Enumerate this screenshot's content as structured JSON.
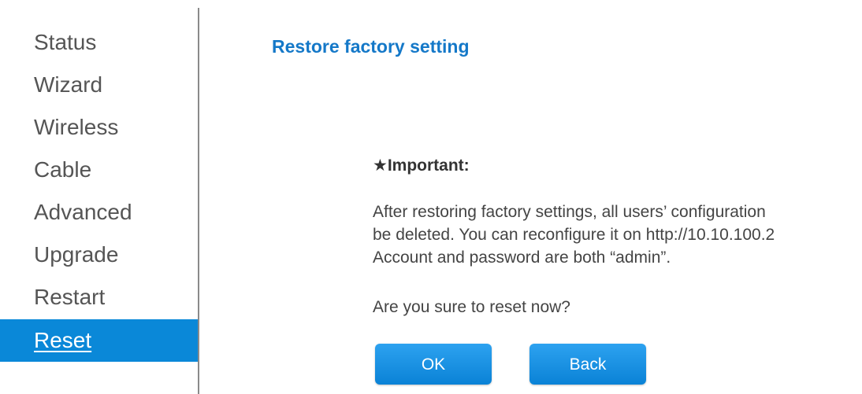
{
  "sidebar": {
    "items": [
      {
        "label": "Status"
      },
      {
        "label": "Wizard"
      },
      {
        "label": "Wireless"
      },
      {
        "label": "Cable"
      },
      {
        "label": "Advanced"
      },
      {
        "label": "Upgrade"
      },
      {
        "label": "Restart"
      },
      {
        "label": "Reset",
        "active": true
      }
    ]
  },
  "main": {
    "title": "Restore factory setting",
    "important_label": "★Important:",
    "message_lines": [
      "After restoring factory settings, all users’ configuration",
      "be deleted. You can reconfigure it on http://10.10.100.2",
      "Account and password are both “admin”."
    ],
    "question": "Are you sure to reset now?",
    "ok_label": "OK",
    "back_label": "Back"
  },
  "colors": {
    "accent": "#0a88d8",
    "title": "#1478c8",
    "text": "#444444"
  }
}
